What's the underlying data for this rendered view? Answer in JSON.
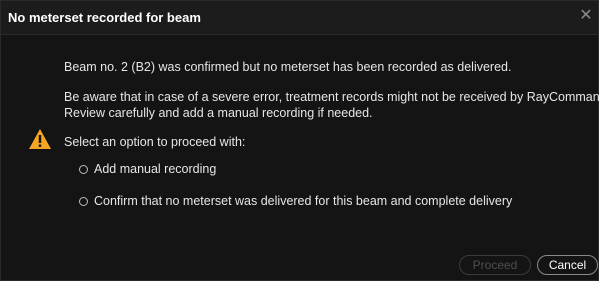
{
  "dialog": {
    "title": "No meterset recorded for beam",
    "close_label": "✕",
    "message_1": "Beam no. 2 (B2) was confirmed but no meterset has been recorded as delivered.",
    "message_2_line_1": "Be aware that in case of a severe error, treatment records might not be received by RayCommand.",
    "message_2_line_2": "Review carefully and add a manual recording if needed.",
    "prompt": "Select an option to proceed with:",
    "options": [
      {
        "label": "Add manual recording",
        "selected": false
      },
      {
        "label": "Confirm that no meterset was delivered for this beam and complete delivery",
        "selected": false
      }
    ],
    "buttons": {
      "proceed": "Proceed",
      "cancel": "Cancel"
    }
  },
  "icons": {
    "warning": "warning-icon",
    "close": "close-icon",
    "radio": "radio-button-icon"
  },
  "colors": {
    "background": "#141414",
    "title_bar": "#1c1c1c",
    "warning": "#f5a623",
    "text": "#e6e6e6",
    "disabled_text": "#4e4e4e"
  }
}
